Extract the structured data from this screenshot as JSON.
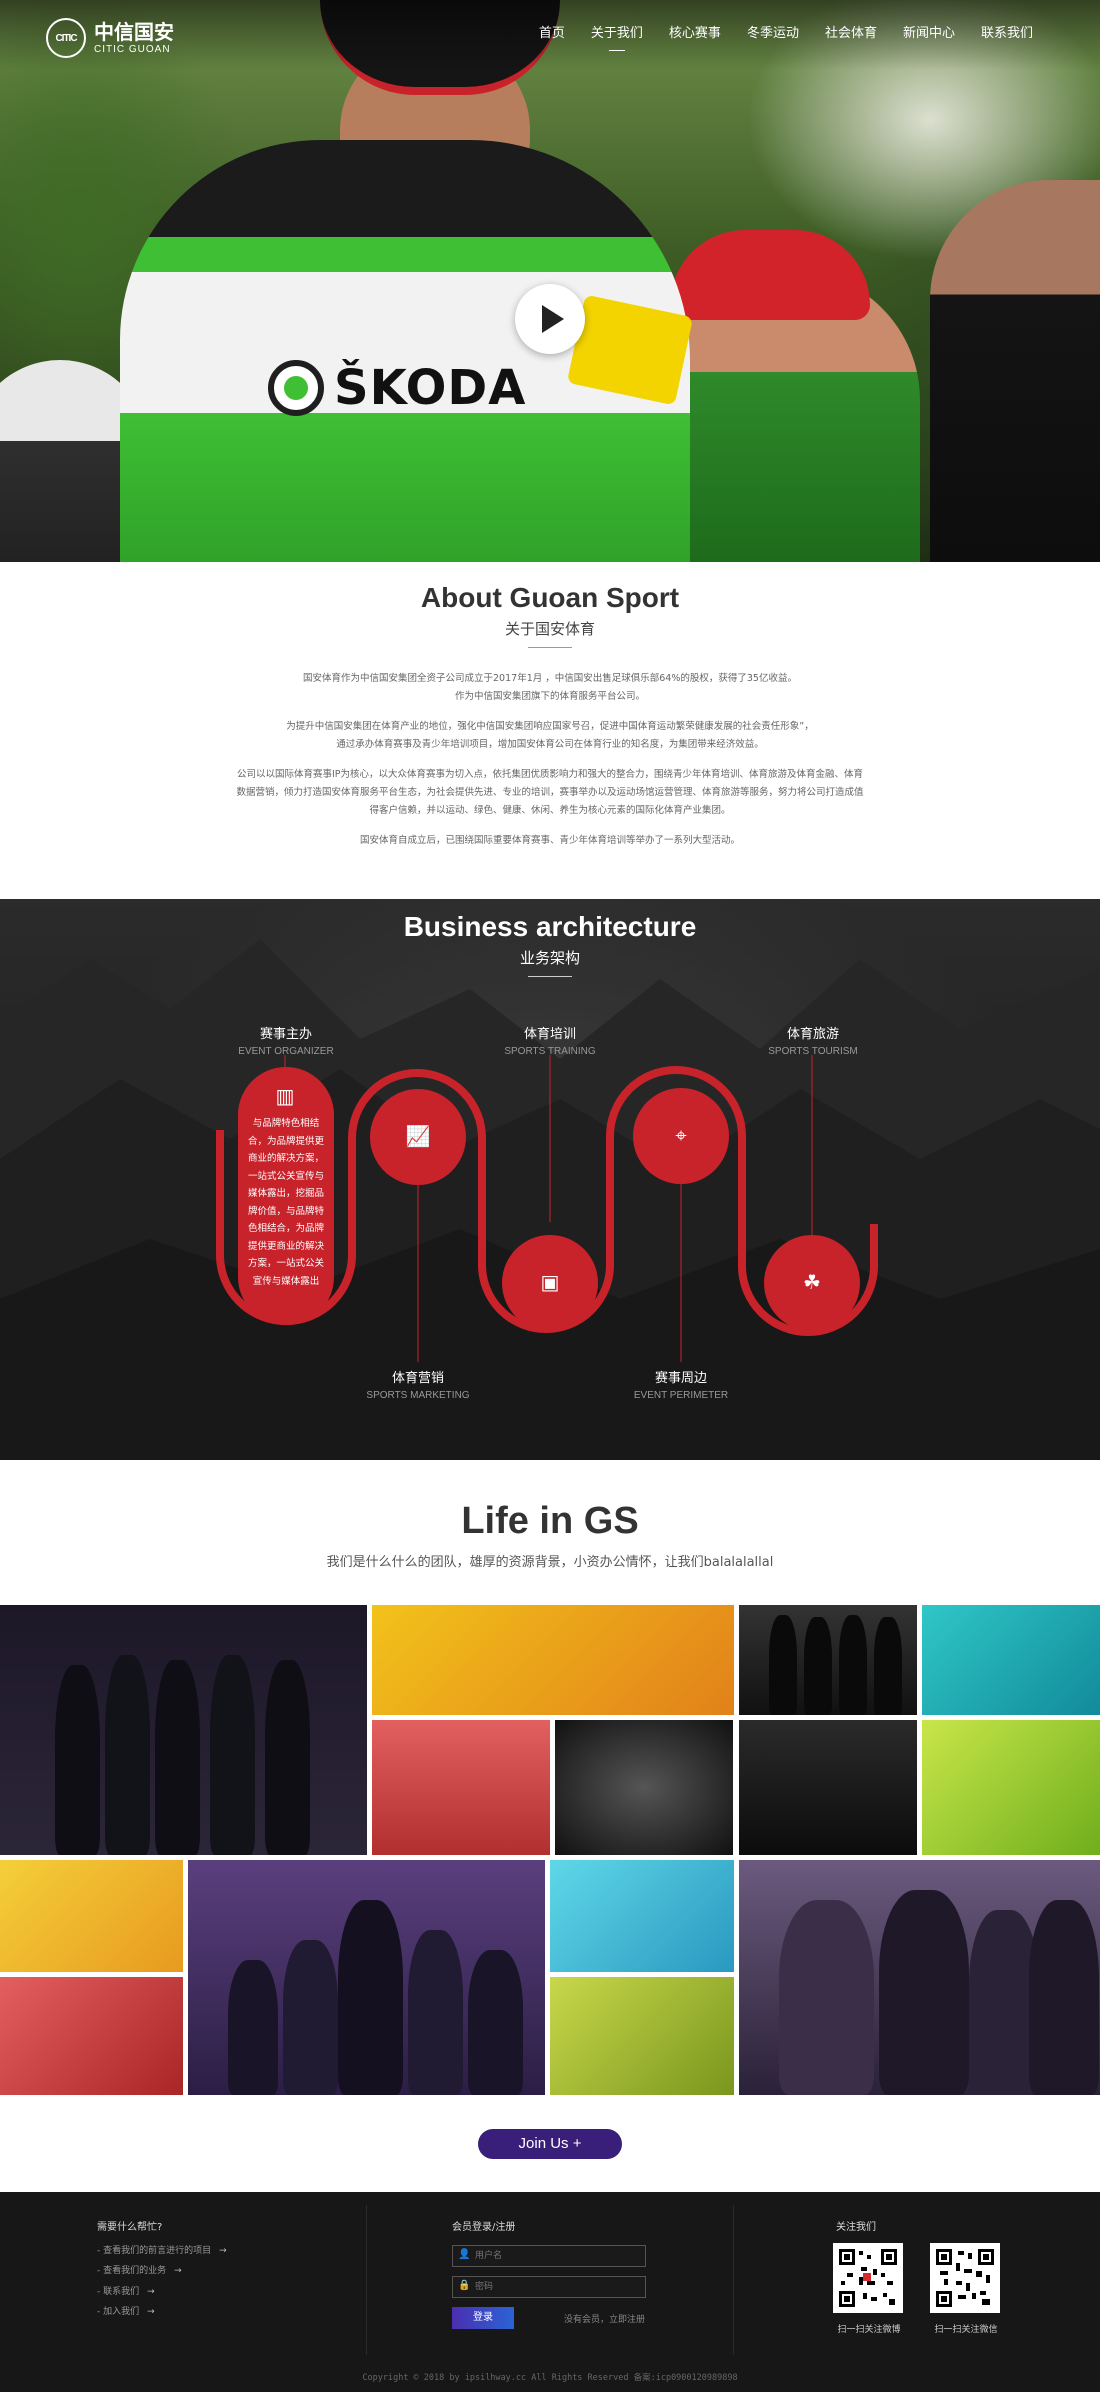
{
  "brand": {
    "logo_mark": "CITIC",
    "name_cn": "中信国安",
    "name_en": "CITIC GUOAN"
  },
  "nav": {
    "items": [
      "首页",
      "关于我们",
      "核心赛事",
      "冬季运动",
      "社会体育",
      "新闻中心",
      "联系我们"
    ],
    "active_index": 1
  },
  "hero": {
    "jersey_text": "ŠKODA",
    "accent_color": "#3fbf34"
  },
  "about": {
    "title_en": "About Guoan Sport",
    "title_cn": "关于国安体育",
    "paragraphs": [
      [
        "国安体育作为中信国安集团全资子公司成立于2017年1月 ，中信国安出售足球俱乐部64%的股权，获得了35亿收益。",
        "作为中信国安集团旗下的体育服务平台公司。"
      ],
      [
        "为提升中信国安集团在体育产业的地位，强化中信国安集团响应国家号召，促进中国体育运动繁荣健康发展的社会责任形象”，",
        "通过承办体育赛事及青少年培训项目，增加国安体育公司在体育行业的知名度，为集团带来经济效益。"
      ],
      [
        "公司以以国际体育赛事IP为核心，以大众体育赛事为切入点，依托集团优质影响力和强大的整合力，围绕青少年体育培训、体育旅游及体育金融、体育",
        "数据营销，倾力打造国安体育服务平台生态，为社会提供先进、专业的培训，赛事举办以及运动场馆运营管理、体育旅游等服务，努力将公司打造成值",
        "得客户信赖，并以运动、绿色、健康、休闲、养生为核心元素的国际化体育产业集团。"
      ],
      [
        "国安体育自成立后，已围绕国际重要体育赛事、青少年体育培训等举办了一系列大型活动。"
      ]
    ]
  },
  "business": {
    "title_en": "Business architecture",
    "title_cn": "业务架构",
    "accent_color": "#c8232b",
    "nodes": [
      {
        "cn": "赛事主办",
        "en": "EVENT ORGANIZER",
        "icon": "building-icon"
      },
      {
        "cn": "体育营销",
        "en": "SPORTS MARKETING",
        "icon": "chart-icon"
      },
      {
        "cn": "体育培训",
        "en": "SPORTS TRAINING",
        "icon": "presentation-icon"
      },
      {
        "cn": "赛事周边",
        "en": "EVENT PERIMETER",
        "icon": "map-pin-icon"
      },
      {
        "cn": "体育旅游",
        "en": "SPORTS TOURISM",
        "icon": "palm-tree-icon"
      }
    ],
    "organizer_text": "与品牌特色相结合，为品牌提供更商业的解决方案，一站式公关宣传与媒体露出，挖掘品牌价值，与品牌特色相结合，为品牌提供更商业的解决方案，一站式公关宣传与媒体露出"
  },
  "life": {
    "title": "Life in GS",
    "subtitle": "我们是什么什么的团队，雄厚的资源背景，小资办公情怀，让我们balalalallal"
  },
  "join_button": "Join Us  +",
  "footer": {
    "help": {
      "title": "需要什么帮忙?",
      "links": [
        "查看我们的前言进行的项目",
        "查看我们的业务",
        "联系我们",
        "加入我们"
      ]
    },
    "member": {
      "title": "会员登录/注册",
      "username_placeholder": "用户名",
      "password_placeholder": "密码",
      "login": "登录",
      "register": "没有会员，立即注册"
    },
    "follow": {
      "title": "关注我们",
      "weibo_caption": "扫一扫关注微博",
      "wechat_caption": "扫一扫关注微信"
    },
    "copyright": "Copyright © 2018 by ipsilhway.cc    All Rights Reserved    备案:icp0900120989898"
  }
}
